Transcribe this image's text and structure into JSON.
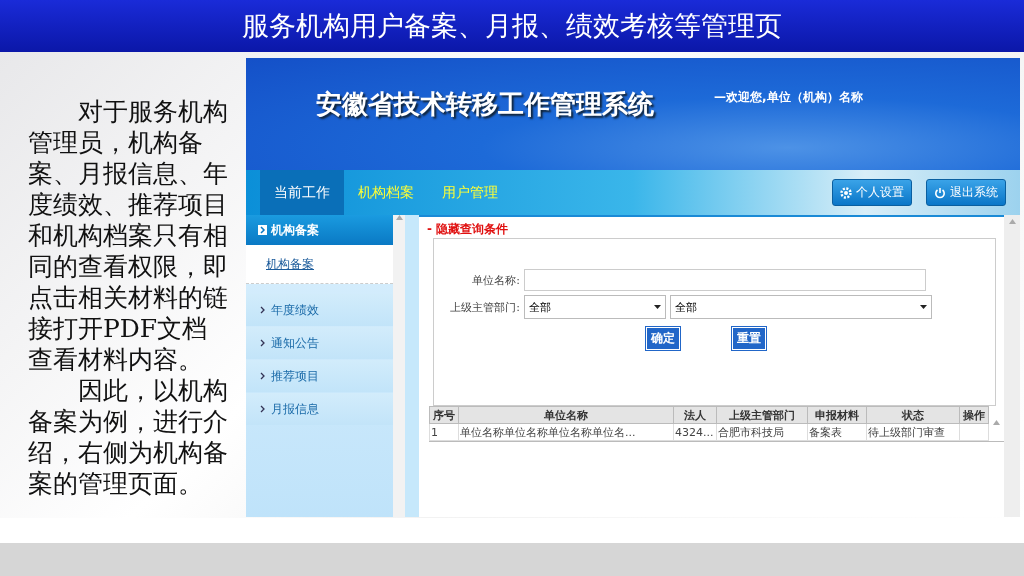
{
  "slide": {
    "title": "服务机构用户备案、月报、绩效考核等管理页",
    "paragraphs": [
      "对于服务机构管理员，机构备案、月报信息、年度绩效、推荐项目和机构档案只有相同的查看权限，即点击相关材料的链接打开PDF文档查看材料内容。",
      "因此，以机构备案为例，进行介绍，右侧为机构备案的管理页面。"
    ]
  },
  "app": {
    "title": "安徽省技术转移工作管理系统",
    "welcome": "—欢迎您,单位（机构）名称",
    "tabs": [
      {
        "label": "当前工作",
        "selected": true
      },
      {
        "label": "机构档案",
        "selected": false
      },
      {
        "label": "用户管理",
        "selected": false
      }
    ],
    "header_buttons": [
      {
        "label": "个人设置",
        "kind": "settings"
      },
      {
        "label": "退出系统",
        "kind": "power"
      }
    ],
    "sidebar": {
      "header": "机构备案",
      "links": [
        "机构备案"
      ],
      "items": [
        "年度绩效",
        "通知公告",
        "推荐项目",
        "月报信息"
      ]
    },
    "filter_toggle": "- 隐藏查询条件",
    "form": {
      "name_label": "单位名称:",
      "dept_label": "上级主管部门:",
      "dept_select_1": "全部",
      "dept_select_2": "全部",
      "buttons": [
        "确定",
        "重置"
      ]
    },
    "table": {
      "columns": [
        "序号",
        "单位名称",
        "法人",
        "上级主管部门",
        "申报材料",
        "状态",
        "操作"
      ],
      "rows": [
        [
          "1",
          "单位名称单位名称单位名称单位名...",
          "4324...",
          "合肥市科技局",
          "备案表",
          "待上级部门审查",
          ""
        ]
      ]
    }
  }
}
